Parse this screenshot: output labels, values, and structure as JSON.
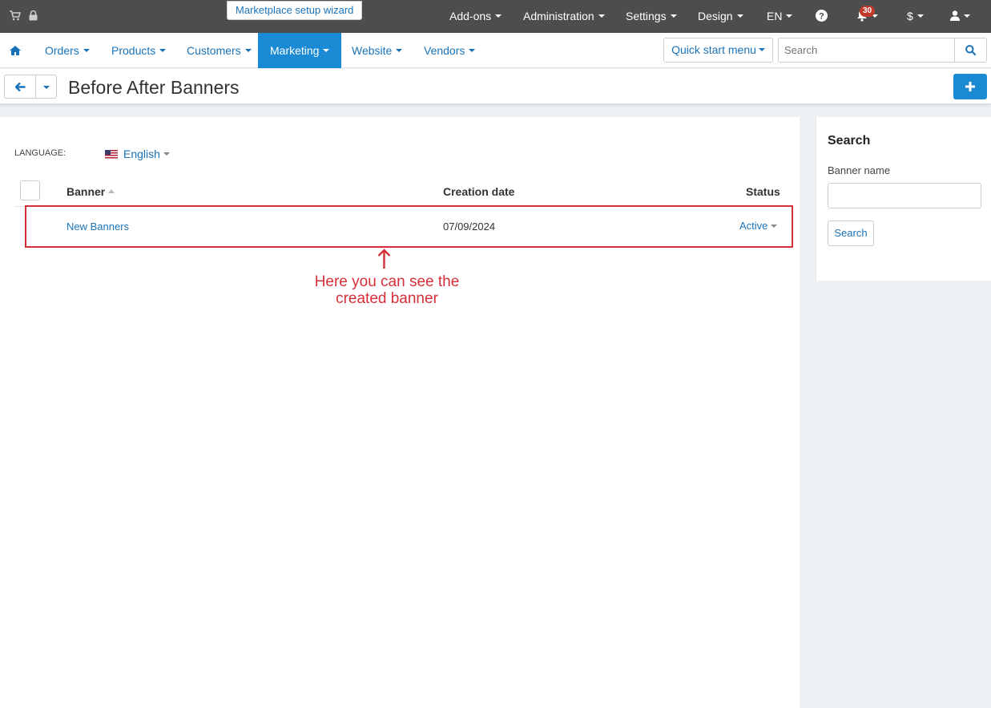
{
  "topbar": {
    "wizard_label": "Marketplace setup wizard",
    "menus": [
      "Add-ons",
      "Administration",
      "Settings",
      "Design",
      "EN"
    ],
    "notifications_count": "30",
    "currency": "$"
  },
  "nav": {
    "items": [
      "Orders",
      "Products",
      "Customers",
      "Marketing",
      "Website",
      "Vendors"
    ],
    "active": "Marketing",
    "quick_start": "Quick start menu",
    "search_placeholder": "Search"
  },
  "page": {
    "title": "Before After Banners"
  },
  "filter": {
    "language_label": "LANGUAGE:",
    "language_value": "English"
  },
  "table": {
    "headers": [
      "Banner",
      "Creation date",
      "Status"
    ],
    "rows": [
      {
        "banner": "New Banners",
        "date": "07/09/2024",
        "status": "Active"
      }
    ]
  },
  "annotation": {
    "line1": "Here you can see the",
    "line2": "created banner"
  },
  "sidebar": {
    "title": "Search",
    "field_label": "Banner name",
    "field_value": "",
    "button": "Search"
  },
  "colors": {
    "accent": "#1a8ad4",
    "topbar": "#4d4d4d",
    "annotation": "#d62f3a"
  }
}
